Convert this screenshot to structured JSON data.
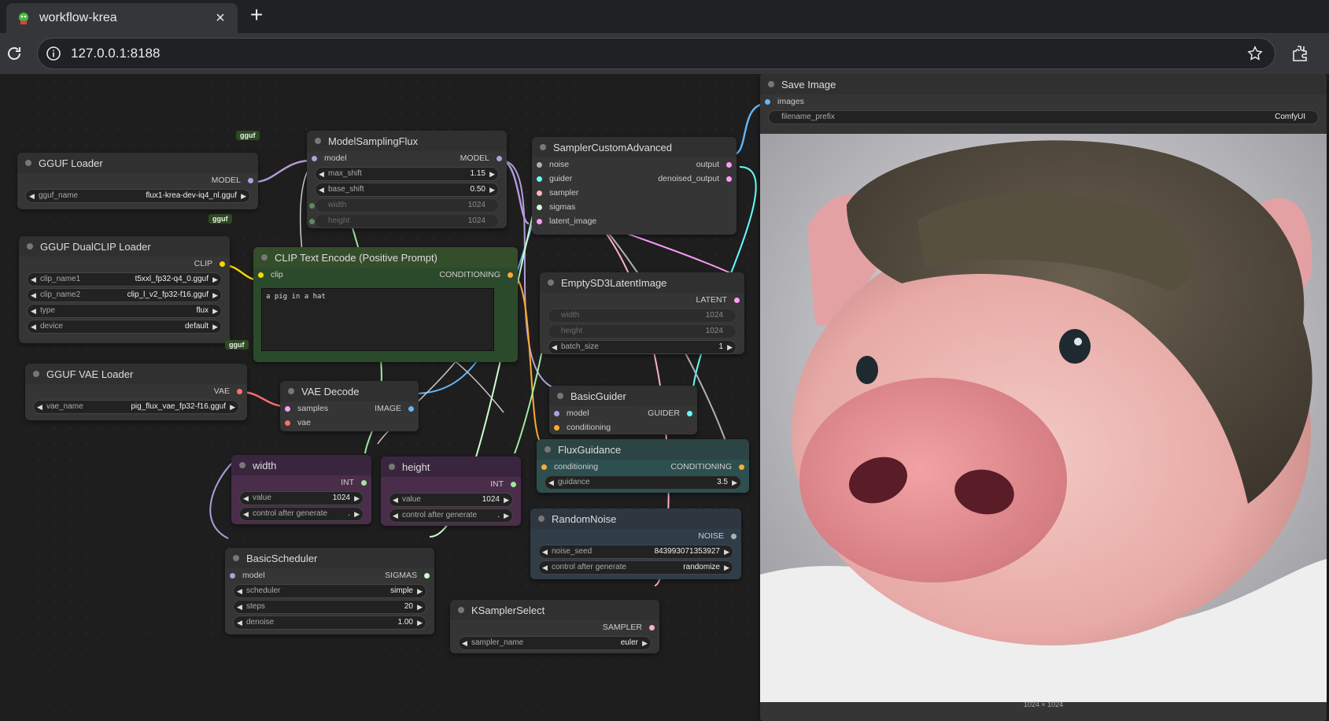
{
  "tab": {
    "title": "workflow-krea",
    "close": "×",
    "new": "+"
  },
  "address": {
    "url": "127.0.0.1:8188"
  },
  "nodes": {
    "gguf_loader": {
      "badge": "gguf",
      "title": "GGUF Loader",
      "out": "MODEL",
      "w": [
        {
          "label": "gguf_name",
          "value": "flux1-krea-dev-iq4_nl.gguf"
        }
      ]
    },
    "dualclip": {
      "badge": "gguf",
      "title": "GGUF DualCLIP Loader",
      "out": "CLIP",
      "w": [
        {
          "label": "clip_name1",
          "value": "t5xxl_fp32-q4_0.gguf"
        },
        {
          "label": "clip_name2",
          "value": "clip_l_v2_fp32-f16.gguf"
        },
        {
          "label": "type",
          "value": "flux"
        },
        {
          "label": "device",
          "value": "default"
        }
      ]
    },
    "vae_loader": {
      "badge": "gguf",
      "title": "GGUF VAE Loader",
      "out": "VAE",
      "w": [
        {
          "label": "vae_name",
          "value": "pig_flux_vae_fp32-f16.gguf"
        }
      ]
    },
    "msf": {
      "title": "ModelSamplingFlux",
      "in": "model",
      "out": "MODEL",
      "w": [
        {
          "label": "max_shift",
          "value": "1.15"
        },
        {
          "label": "base_shift",
          "value": "0.50"
        }
      ],
      "i": [
        {
          "label": "width",
          "value": "1024"
        },
        {
          "label": "height",
          "value": "1024"
        }
      ]
    },
    "clip_enc": {
      "title": "CLIP Text Encode (Positive Prompt)",
      "in": "clip",
      "out": "CONDITIONING",
      "text": "a pig in a hat"
    },
    "sca": {
      "title": "SamplerCustomAdvanced",
      "ins": [
        "noise",
        "guider",
        "sampler",
        "sigmas",
        "latent_image"
      ],
      "outs": [
        "output",
        "denoised_output"
      ]
    },
    "empty": {
      "title": "EmptySD3LatentImage",
      "out": "LATENT",
      "i": [
        {
          "label": "width",
          "value": "1024"
        },
        {
          "label": "height",
          "value": "1024"
        }
      ],
      "w": [
        {
          "label": "batch_size",
          "value": "1"
        }
      ]
    },
    "vae_decode": {
      "title": "VAE Decode",
      "ins": [
        "samples",
        "vae"
      ],
      "out": "IMAGE"
    },
    "guider": {
      "title": "BasicGuider",
      "ins": [
        "model",
        "conditioning"
      ],
      "out": "GUIDER"
    },
    "fluxg": {
      "title": "FluxGuidance",
      "in": "conditioning",
      "out": "CONDITIONING",
      "w": [
        {
          "label": "guidance",
          "value": "3.5"
        }
      ]
    },
    "width": {
      "title": "width",
      "out": "INT",
      "w": [
        {
          "label": "value",
          "value": "1024"
        },
        {
          "label": "control after generate",
          "value": "."
        }
      ]
    },
    "height": {
      "title": "height",
      "out": "INT",
      "w": [
        {
          "label": "value",
          "value": "1024"
        },
        {
          "label": "control after generate",
          "value": "."
        }
      ]
    },
    "noise": {
      "title": "RandomNoise",
      "out": "NOISE",
      "w": [
        {
          "label": "noise_seed",
          "value": "843993071353927"
        },
        {
          "label": "control after generate",
          "value": "randomize"
        }
      ]
    },
    "sched": {
      "title": "BasicScheduler",
      "in": "model",
      "out": "SIGMAS",
      "w": [
        {
          "label": "scheduler",
          "value": "simple"
        },
        {
          "label": "steps",
          "value": "20"
        },
        {
          "label": "denoise",
          "value": "1.00"
        }
      ]
    },
    "ksel": {
      "title": "KSamplerSelect",
      "out": "SAMPLER",
      "w": [
        {
          "label": "sampler_name",
          "value": "euler"
        }
      ]
    },
    "save": {
      "title": "Save Image",
      "in": "images",
      "w": [
        {
          "label": "filename_prefix",
          "value": "ComfyUI"
        }
      ],
      "caption": "1024 × 1024"
    }
  },
  "colors": {
    "model": "#b39ddb",
    "clip": "#ffd500",
    "vae": "#ff6e6e",
    "conditioning": "#ffa931",
    "latent": "#ff9cf9",
    "image": "#64b5f6",
    "int": "#a1e8a1",
    "noise": "#b0b0b0",
    "sigmas": "#cdffcd",
    "sampler": "#ffb2c4",
    "guider": "#66ffff"
  }
}
